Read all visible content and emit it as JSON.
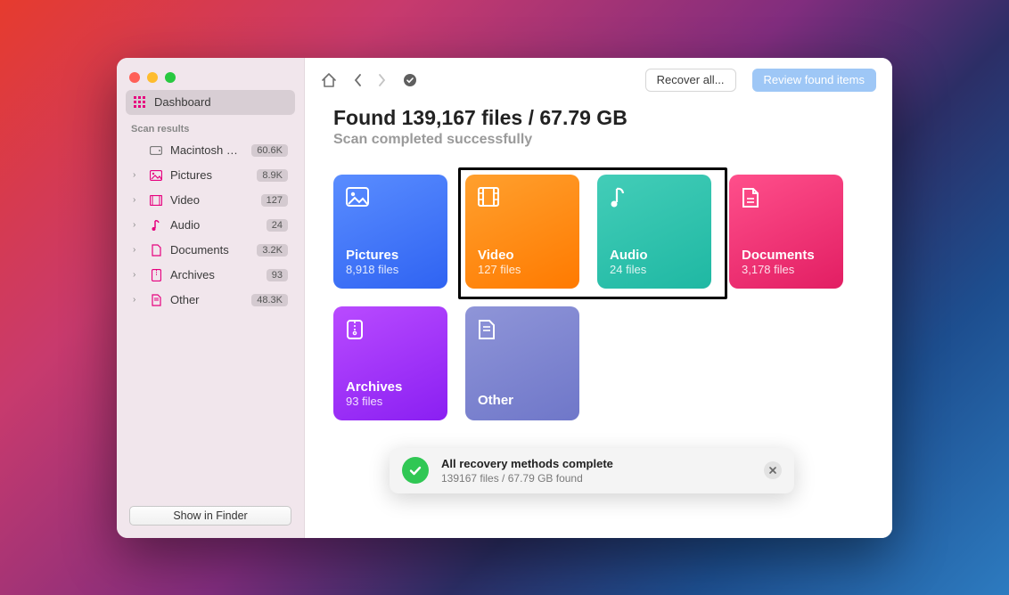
{
  "sidebar": {
    "dashboard_label": "Dashboard",
    "scan_results_header": "Scan results",
    "disk": {
      "label": "Macintosh HD -…",
      "badge": "60.6K"
    },
    "items": [
      {
        "label": "Pictures",
        "badge": "8.9K"
      },
      {
        "label": "Video",
        "badge": "127"
      },
      {
        "label": "Audio",
        "badge": "24"
      },
      {
        "label": "Documents",
        "badge": "3.2K"
      },
      {
        "label": "Archives",
        "badge": "93"
      },
      {
        "label": "Other",
        "badge": "48.3K"
      }
    ],
    "show_in_finder_label": "Show in Finder"
  },
  "toolbar": {
    "recover_all_label": "Recover all...",
    "review_label": "Review found items"
  },
  "summary": {
    "title": "Found 139,167 files / 67.79 GB",
    "subtitle": "Scan completed successfully"
  },
  "cards": {
    "pictures": {
      "title": "Pictures",
      "sub": "8,918 files"
    },
    "video": {
      "title": "Video",
      "sub": "127 files"
    },
    "audio": {
      "title": "Audio",
      "sub": "24 files"
    },
    "documents": {
      "title": "Documents",
      "sub": "3,178 files"
    },
    "archives": {
      "title": "Archives",
      "sub": "93 files"
    },
    "other": {
      "title": "Other",
      "sub": ""
    }
  },
  "toast": {
    "title": "All recovery methods complete",
    "subtitle": "139167 files / 67.79 GB found"
  }
}
